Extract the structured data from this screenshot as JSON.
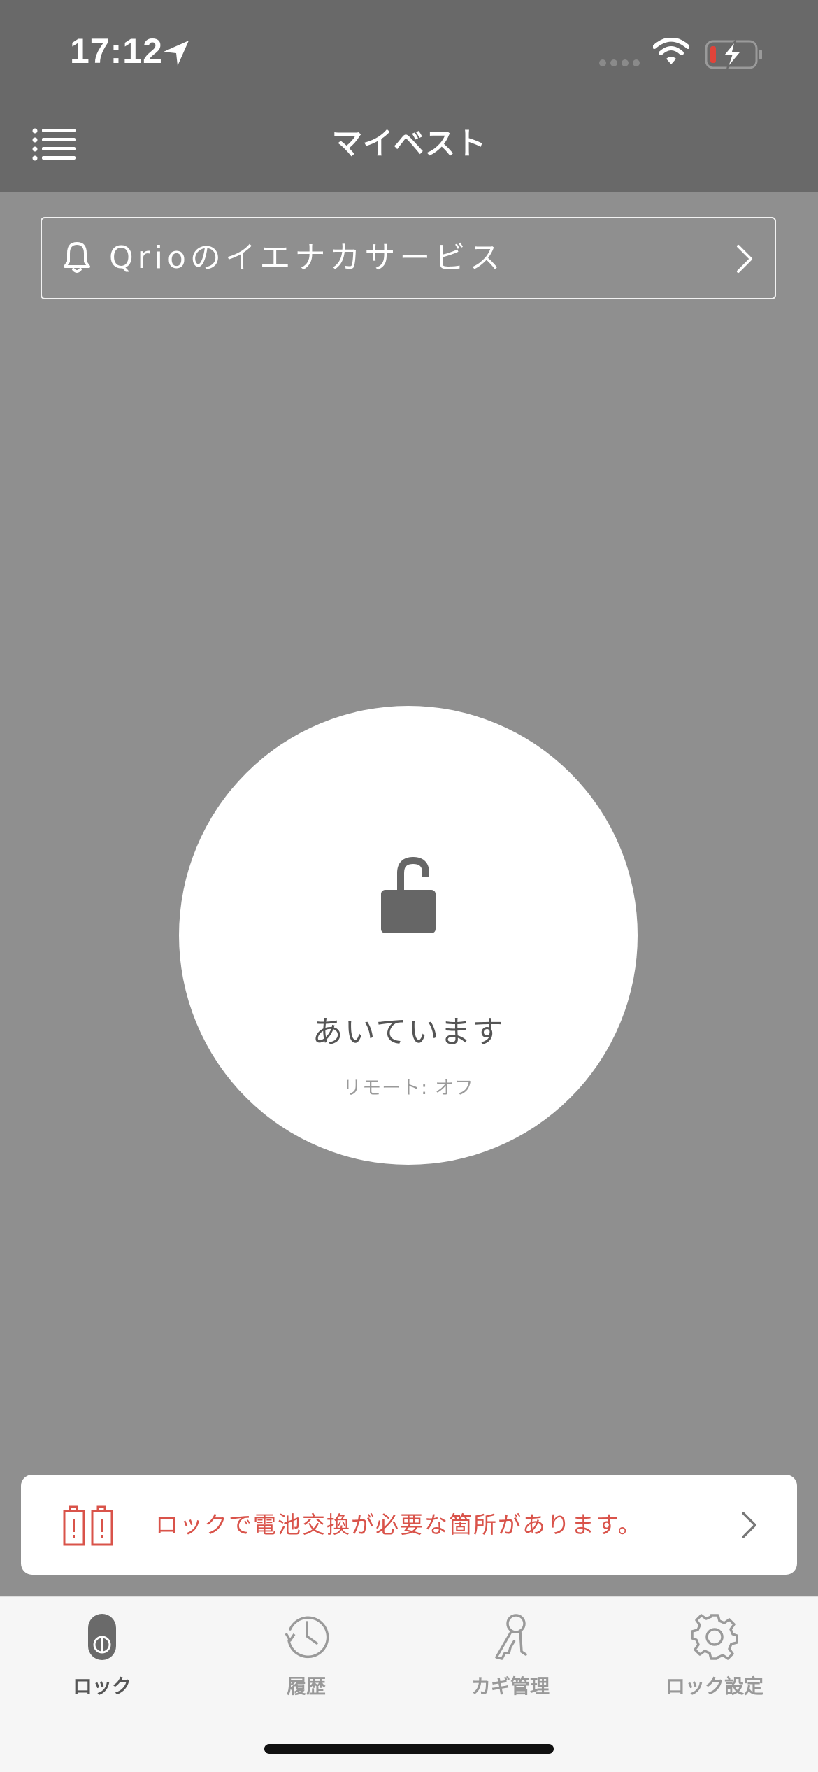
{
  "status_bar": {
    "time": "17:12",
    "icons": [
      "location-arrow-icon",
      "cellular-signal-icon",
      "wifi-icon",
      "battery-charging-icon"
    ]
  },
  "nav": {
    "title": "マイベスト",
    "menu_icon": "menu-list-icon"
  },
  "service_banner": {
    "icon": "bell-icon",
    "label": "Qrioのイエナカサービス",
    "chevron": "chevron-right-icon"
  },
  "lock": {
    "icon": "unlocked-padlock-icon",
    "status": "あいています",
    "remote_status": "リモート: オフ"
  },
  "battery_alert": {
    "icon": "battery-warning-icon",
    "message": "ロックで電池交換が必要な箇所があります。",
    "chevron": "chevron-right-icon",
    "color": "#d9534a"
  },
  "tabs": [
    {
      "label": "ロック",
      "icon": "lock-device-icon",
      "active": true
    },
    {
      "label": "履歴",
      "icon": "history-clock-icon",
      "active": false
    },
    {
      "label": "カギ管理",
      "icon": "keys-icon",
      "active": false
    },
    {
      "label": "ロック設定",
      "icon": "settings-gear-icon",
      "active": false
    }
  ],
  "colors": {
    "header": "#696969",
    "background": "#8f8f8f",
    "alert": "#d9534a"
  }
}
